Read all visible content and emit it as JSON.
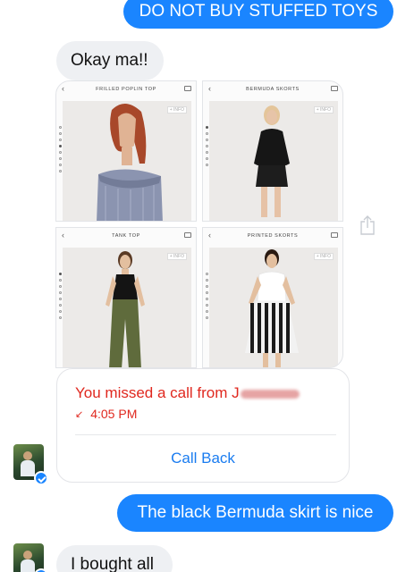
{
  "messages": {
    "outgoing_1": "DO NOT BUY STUFFED TOYS",
    "incoming_1": "Okay ma!!",
    "outgoing_2": "The black Bermuda skirt is nice",
    "incoming_2": "I bought all"
  },
  "photos": [
    {
      "title": "FRILLED POPLIN TOP",
      "info": "+ INFO"
    },
    {
      "title": "BERMUDA SKORTS",
      "info": "+ INFO"
    },
    {
      "title": "TANK TOP",
      "info": "+ INFO"
    },
    {
      "title": "PRINTED SKORTS",
      "info": "+ INFO"
    }
  ],
  "call": {
    "title": "You missed a call from J",
    "time": "4:05 PM",
    "action": "Call Back",
    "color": "#e0281f"
  },
  "icons": {
    "share": "share-icon",
    "missed_call": "missed-call-icon",
    "messenger_badge": "messenger-badge-icon"
  },
  "colors": {
    "outgoing_bubble": "#1a85ff",
    "incoming_bubble": "#eef0f3",
    "link": "#1a7cf0"
  }
}
